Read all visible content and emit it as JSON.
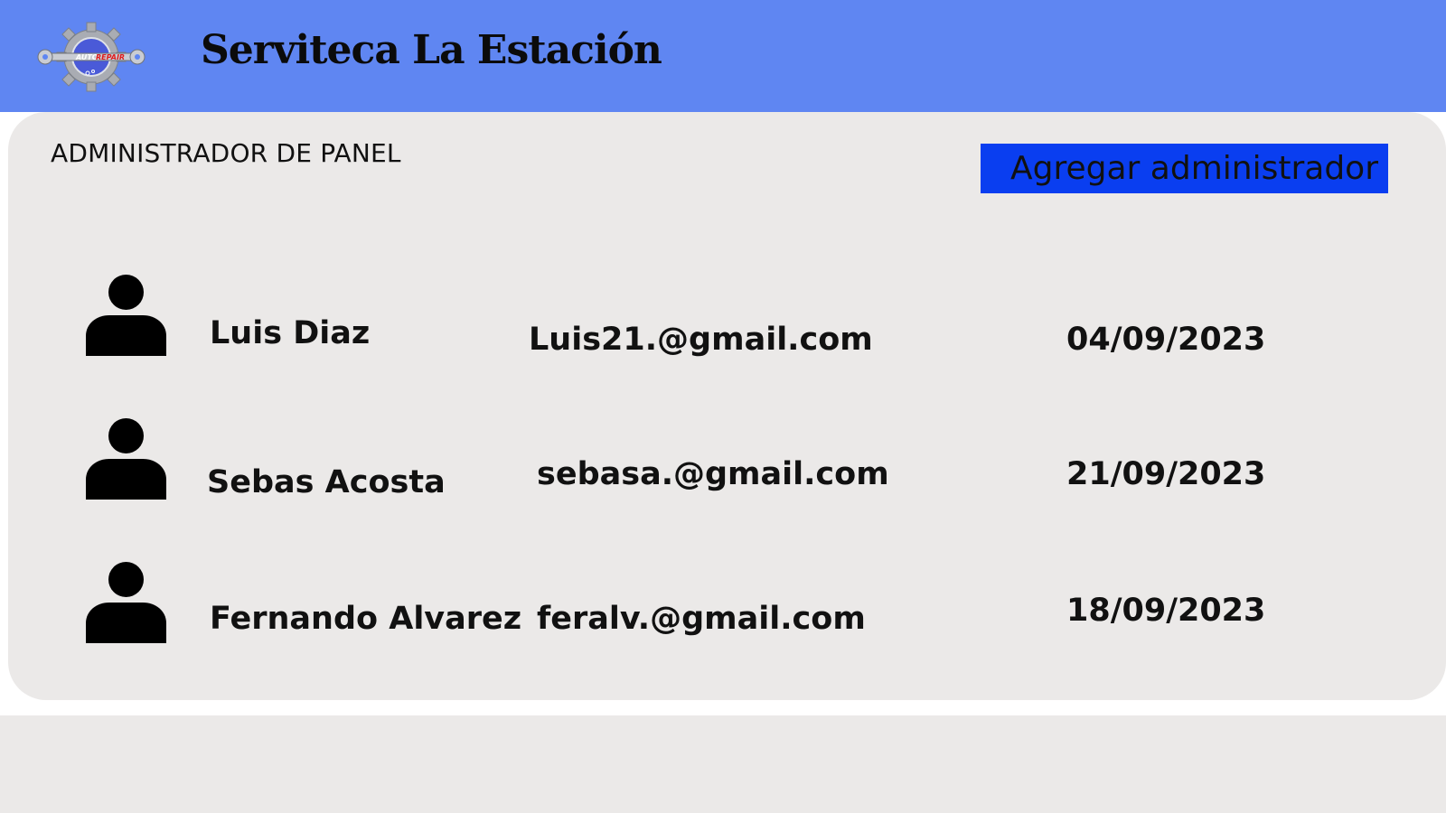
{
  "header": {
    "title": "Serviteca La Estación",
    "logo": {
      "icon": "auto-repair-gear-logo",
      "text_auto": "AUTO",
      "text_repair": "REPAIR"
    }
  },
  "panel": {
    "title": "ADMINISTRADOR DE PANEL",
    "add_button_label": "Agregar administrador"
  },
  "admins": [
    {
      "name": "Luis Diaz",
      "email": "Luis21.@gmail.com",
      "date": "04/09/2023",
      "icon": "user-icon"
    },
    {
      "name": "Sebas Acosta",
      "email": "sebasa.@gmail.com",
      "date": "21/09/2023",
      "icon": "user-icon"
    },
    {
      "name": "Fernando Alvarez",
      "email": "feralv.@gmail.com",
      "date": "18/09/2023",
      "icon": "user-icon"
    }
  ],
  "colors": {
    "header_bg": "#5f86f2",
    "button_bg": "#0a3ef0",
    "panel_bg": "#ebe9e8"
  }
}
